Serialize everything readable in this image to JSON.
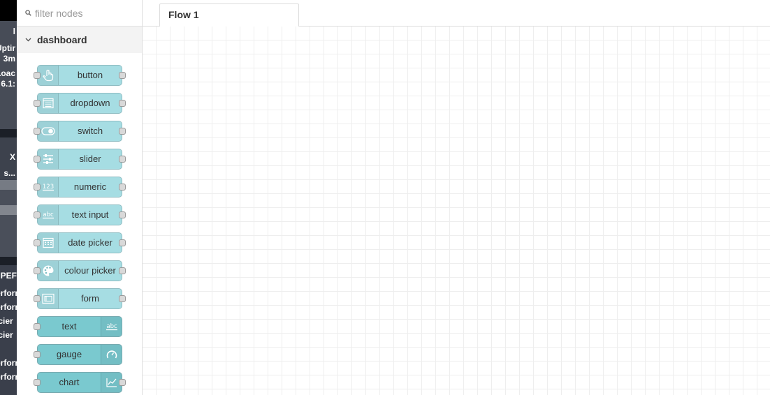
{
  "palette": {
    "filter_placeholder": "filter nodes",
    "category": "dashboard",
    "nodes": [
      {
        "label": "button",
        "icon": "hand-pointer-icon",
        "style": "light",
        "icon_side": "left"
      },
      {
        "label": "dropdown",
        "icon": "list-icon",
        "style": "light",
        "icon_side": "left"
      },
      {
        "label": "switch",
        "icon": "toggle-icon",
        "style": "light",
        "icon_side": "left"
      },
      {
        "label": "slider",
        "icon": "sliders-icon",
        "style": "light",
        "icon_side": "left"
      },
      {
        "label": "numeric",
        "icon": "numeric-123-icon",
        "style": "light",
        "icon_side": "left"
      },
      {
        "label": "text input",
        "icon": "text-abc-icon",
        "style": "light",
        "icon_side": "left"
      },
      {
        "label": "date picker",
        "icon": "calendar-icon",
        "style": "light",
        "icon_side": "left"
      },
      {
        "label": "colour picker",
        "icon": "palette-icon",
        "style": "light",
        "icon_side": "left"
      },
      {
        "label": "form",
        "icon": "form-icon",
        "style": "light",
        "icon_side": "left"
      },
      {
        "label": "text",
        "icon": "text-abc-icon",
        "style": "dark",
        "icon_side": "right"
      },
      {
        "label": "gauge",
        "icon": "gauge-icon",
        "style": "dark",
        "icon_side": "right"
      },
      {
        "label": "chart",
        "icon": "line-chart-icon",
        "style": "dark",
        "icon_side": "right"
      }
    ]
  },
  "workspace": {
    "tabs": [
      {
        "label": "Flow 1"
      }
    ]
  },
  "background_window": {
    "fragments": [
      "l",
      "Uptir",
      "3m",
      "Loac",
      "6.1:",
      "X",
      "s...",
      "JPEF",
      "erforr",
      "erforr",
      "icier",
      "icier",
      "erforr",
      "erforr"
    ]
  },
  "colors": {
    "node_light": "#a6dde3",
    "node_dark": "#7ac9cf",
    "grid_line": "#eeeeee"
  }
}
